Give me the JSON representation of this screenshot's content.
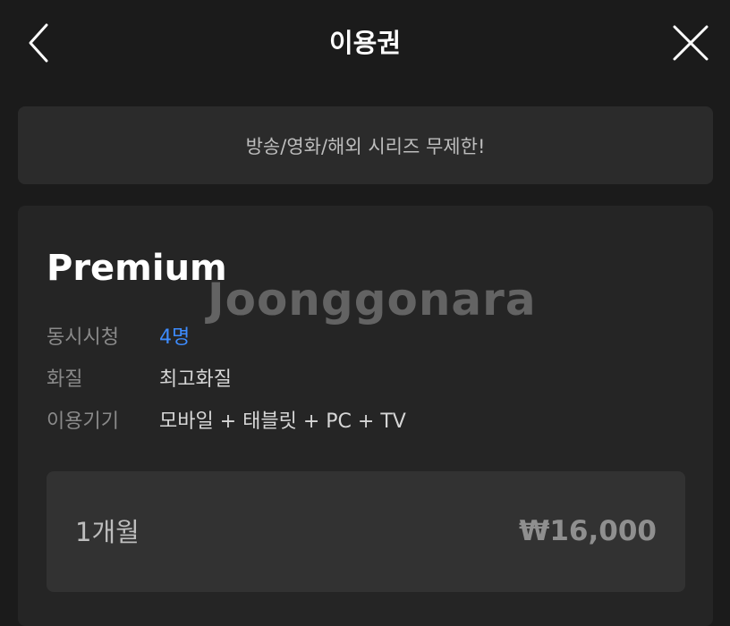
{
  "header": {
    "title": "이용권"
  },
  "banner": {
    "text": "방송/영화/해외 시리즈 무제한!"
  },
  "plan": {
    "name": "Premium",
    "specs": [
      {
        "label": "동시시청",
        "value": "4명"
      },
      {
        "label": "화질",
        "value": "최고화질"
      },
      {
        "label": "이용기기",
        "value": "모바일 + 태블릿 + PC + TV"
      }
    ],
    "period": "1개월",
    "price": "₩16,000"
  },
  "watermark": {
    "text": "Joonggonara"
  },
  "colors": {
    "background": "#1b1b1b",
    "card": "#252525",
    "accent": "#3d8cff"
  },
  "icons": {
    "back": "chevron-left-icon",
    "close": "close-icon"
  }
}
